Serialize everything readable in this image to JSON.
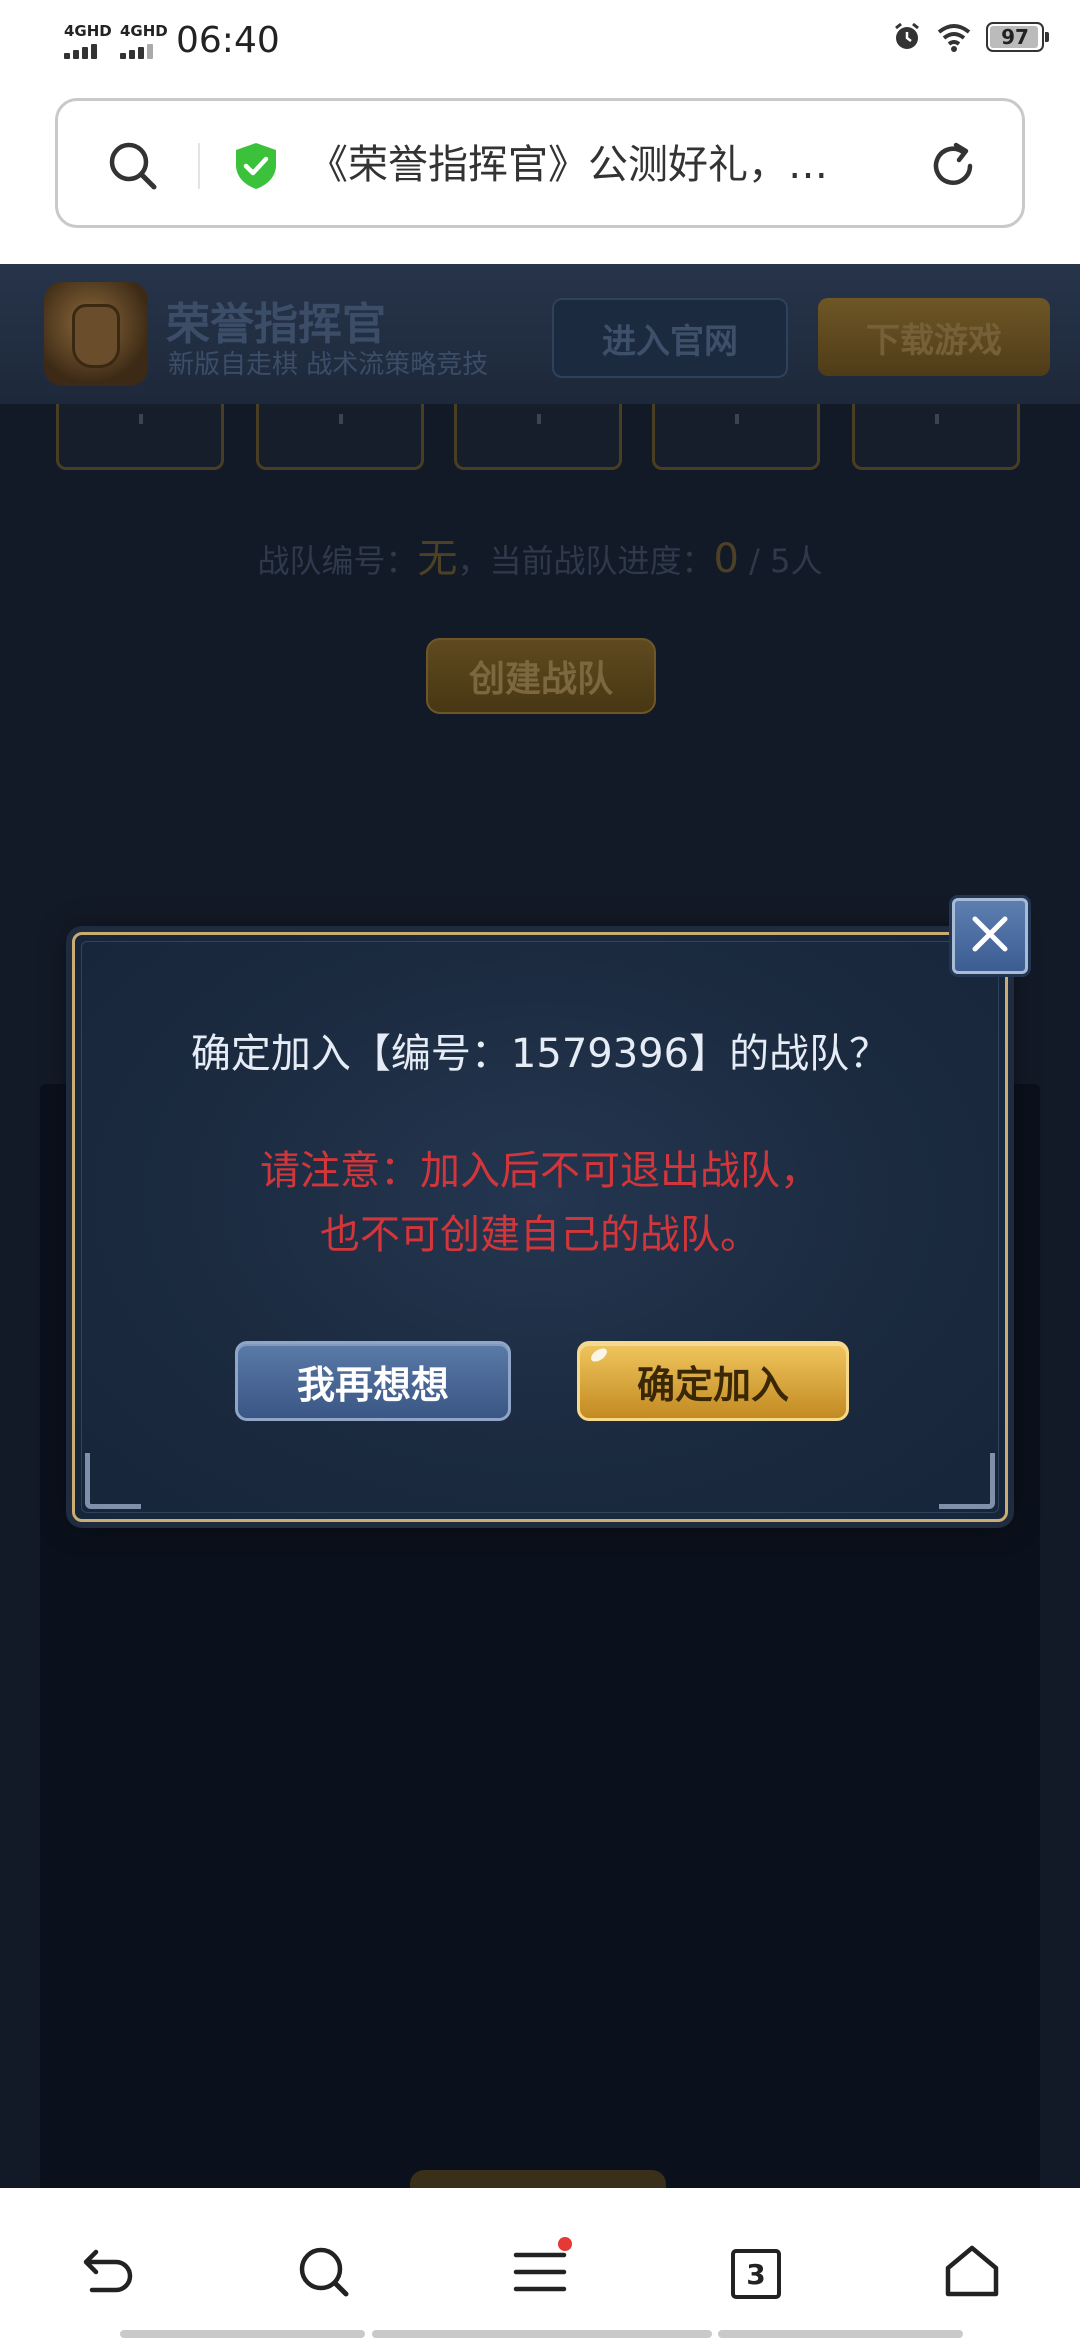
{
  "status_bar": {
    "signal1": "4GHD",
    "signal2": "4GHD",
    "time": "06:40",
    "battery": "97"
  },
  "url_bar": {
    "title": "《荣誉指挥官》公测好礼，…"
  },
  "page": {
    "game_name": "荣誉指挥官",
    "game_subtitle": "新版自走棋 战术流策略竞技",
    "site_button": "进入官网",
    "download_button": "下载游戏",
    "team_label": "战队编号：",
    "team_number": "无",
    "team_progress_label": "，当前战队进度：",
    "team_progress_value": "0",
    "team_progress_total": " / 5人",
    "create_team_button": "创建战队"
  },
  "dialog": {
    "question": "确定加入【编号：1579396】的战队？",
    "warning_line1": "请注意：加入后不可退出战队，",
    "warning_line2": "也不可创建自己的战队。",
    "cancel_button": "我再想想",
    "confirm_button": "确定加入"
  },
  "bottom_nav": {
    "tab_count": "3"
  },
  "colors": {
    "warning_text": "#d3363a",
    "confirm_gold": "#e0ac3f",
    "cancel_blue": "#4a6895",
    "dialog_border": "#c9ad72",
    "overlay_bg": "#131a27"
  },
  "icons": {
    "url_bar": [
      "search-icon",
      "shield-check-icon",
      "reload-icon"
    ],
    "status_bar": [
      "signal-icon",
      "alarm-icon",
      "wifi-icon",
      "battery-icon"
    ],
    "bottom_nav": [
      "back-icon",
      "search-icon",
      "menu-icon",
      "tabs-icon",
      "home-icon"
    ],
    "dialog": [
      "close-icon"
    ]
  }
}
